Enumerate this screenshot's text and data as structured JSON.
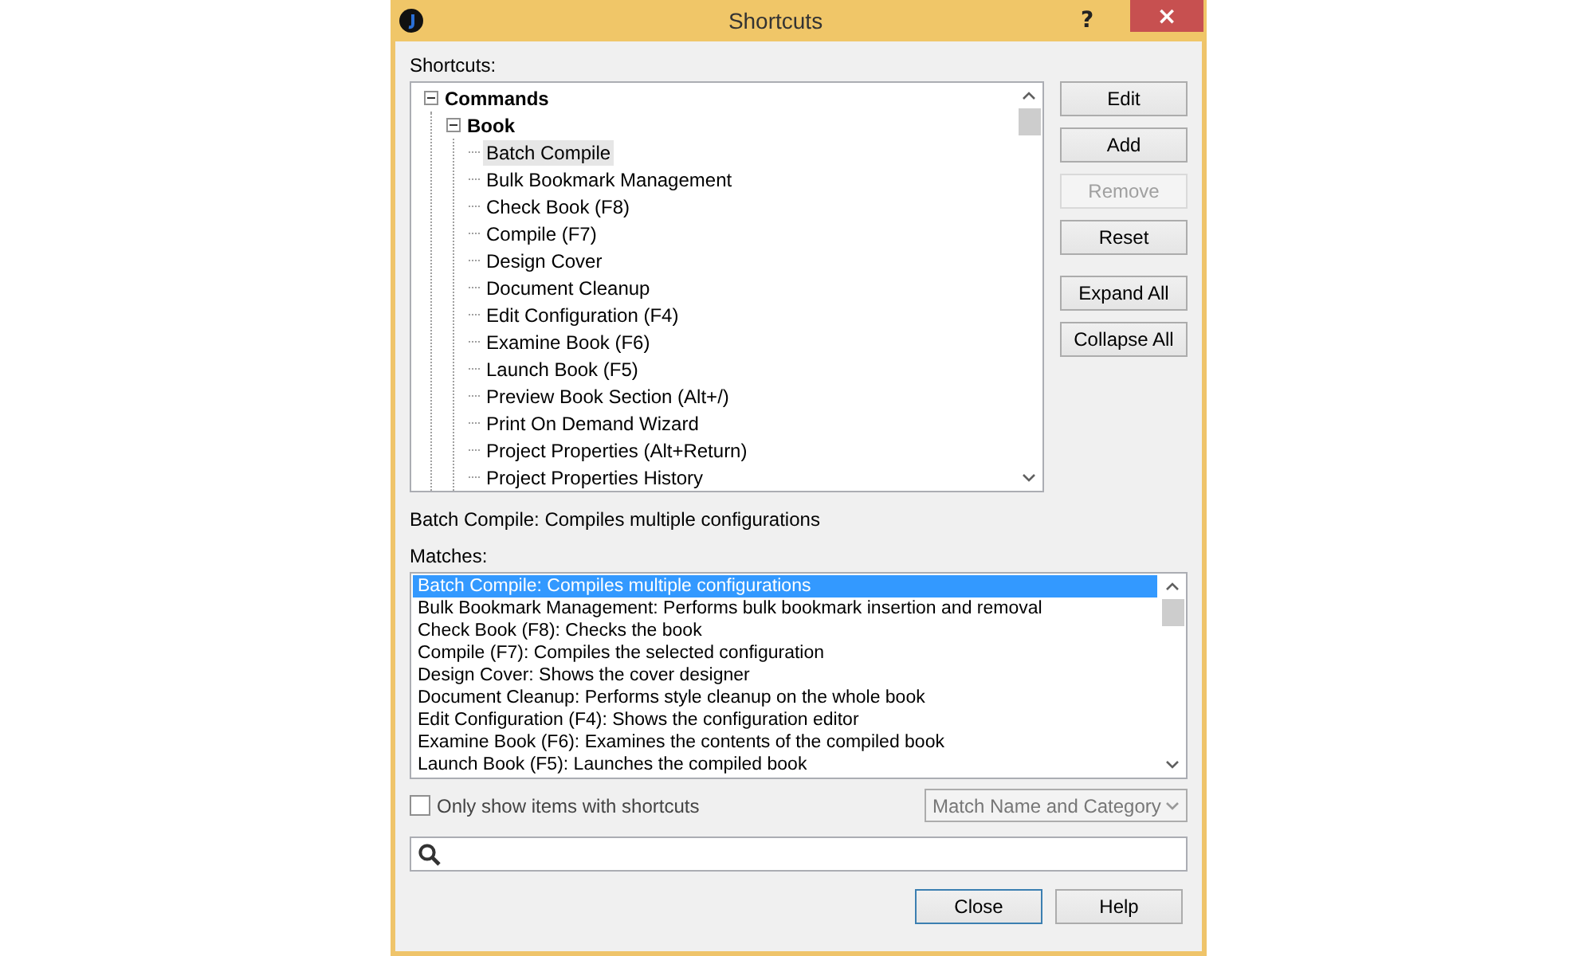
{
  "window": {
    "title": "Shortcuts",
    "help_glyph": "?",
    "close_glyph": "×"
  },
  "tree_label": "Shortcuts:",
  "tree": [
    {
      "label": "Commands",
      "expanded": true,
      "selected": false,
      "children": [
        {
          "label": "Book",
          "expanded": true,
          "selected": false,
          "children": [
            {
              "label": "Batch Compile",
              "selected": true
            },
            {
              "label": "Bulk Bookmark Management",
              "selected": false
            },
            {
              "label": "Check Book (F8)",
              "selected": false
            },
            {
              "label": "Compile (F7)",
              "selected": false
            },
            {
              "label": "Design Cover",
              "selected": false
            },
            {
              "label": "Document Cleanup",
              "selected": false
            },
            {
              "label": "Edit Configuration (F4)",
              "selected": false
            },
            {
              "label": "Examine Book (F6)",
              "selected": false
            },
            {
              "label": "Launch Book (F5)",
              "selected": false
            },
            {
              "label": "Preview Book Section (Alt+/)",
              "selected": false
            },
            {
              "label": "Print On Demand Wizard",
              "selected": false
            },
            {
              "label": "Project Properties (Alt+Return)",
              "selected": false
            },
            {
              "label": "Project Properties History",
              "selected": false
            }
          ]
        }
      ]
    }
  ],
  "side_button_groups": [
    [
      {
        "label": "Edit",
        "disabled": false
      },
      {
        "label": "Add",
        "disabled": false
      },
      {
        "label": "Remove",
        "disabled": true
      },
      {
        "label": "Reset",
        "disabled": false
      }
    ],
    [
      {
        "label": "Expand All",
        "disabled": false
      },
      {
        "label": "Collapse All",
        "disabled": false
      }
    ]
  ],
  "description": "Batch Compile: Compiles multiple configurations",
  "matches_label": "Matches:",
  "matches": [
    {
      "text": "Batch Compile: Compiles multiple configurations",
      "selected": true
    },
    {
      "text": "Bulk Bookmark Management: Performs bulk bookmark insertion and removal",
      "selected": false
    },
    {
      "text": "Check Book (F8): Checks the book",
      "selected": false
    },
    {
      "text": "Compile (F7): Compiles the selected configuration",
      "selected": false
    },
    {
      "text": "Design Cover: Shows the cover designer",
      "selected": false
    },
    {
      "text": "Document Cleanup: Performs style cleanup on the whole book",
      "selected": false
    },
    {
      "text": "Edit Configuration (F4): Shows the configuration editor",
      "selected": false
    },
    {
      "text": "Examine Book (F6): Examines the contents of the compiled book",
      "selected": false
    },
    {
      "text": "Launch Book (F5): Launches the compiled book",
      "selected": false
    }
  ],
  "filter_checkbox": {
    "label": "Only show items with shortcuts",
    "checked": false
  },
  "match_mode": {
    "value": "Match Name and Category"
  },
  "footer_buttons": [
    {
      "label": "Close",
      "default": true
    },
    {
      "label": "Help",
      "default": false
    }
  ]
}
